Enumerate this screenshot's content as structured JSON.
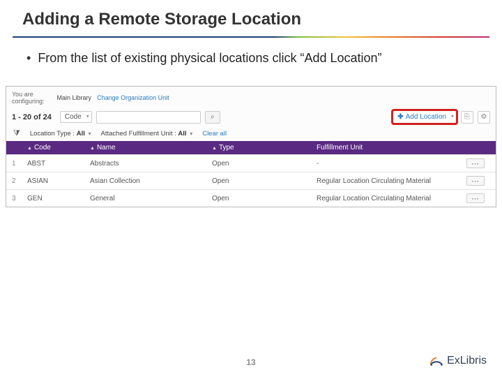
{
  "title": "Adding a Remote Storage Location",
  "bullet": "From the list of existing physical locations click “Add Location”",
  "config": {
    "label_top": "You are",
    "label_bottom": "configuring:",
    "main": "Main Library",
    "link": "Change Organization Unit"
  },
  "toolbar": {
    "range": "1 - 20 of 24",
    "sort_field": "Code",
    "add_label": "Add Location"
  },
  "filters": {
    "type_label": "Location Type :",
    "type_value": "All",
    "fu_label": "Attached Fulfillment Unit :",
    "fu_value": "All",
    "clear": "Clear all"
  },
  "columns": {
    "code": "Code",
    "name": "Name",
    "type": "Type",
    "fu": "Fulfillment Unit"
  },
  "rows": [
    {
      "n": "1",
      "code": "ABST",
      "name": "Abstracts",
      "type": "Open",
      "fu": "-"
    },
    {
      "n": "2",
      "code": "ASIAN",
      "name": "Asian Collection",
      "type": "Open",
      "fu": "Regular Location Circulating Material"
    },
    {
      "n": "3",
      "code": "GEN",
      "name": "General",
      "type": "Open",
      "fu": "Regular Location Circulating Material"
    }
  ],
  "page_number": "13",
  "brand": "ExLibris"
}
